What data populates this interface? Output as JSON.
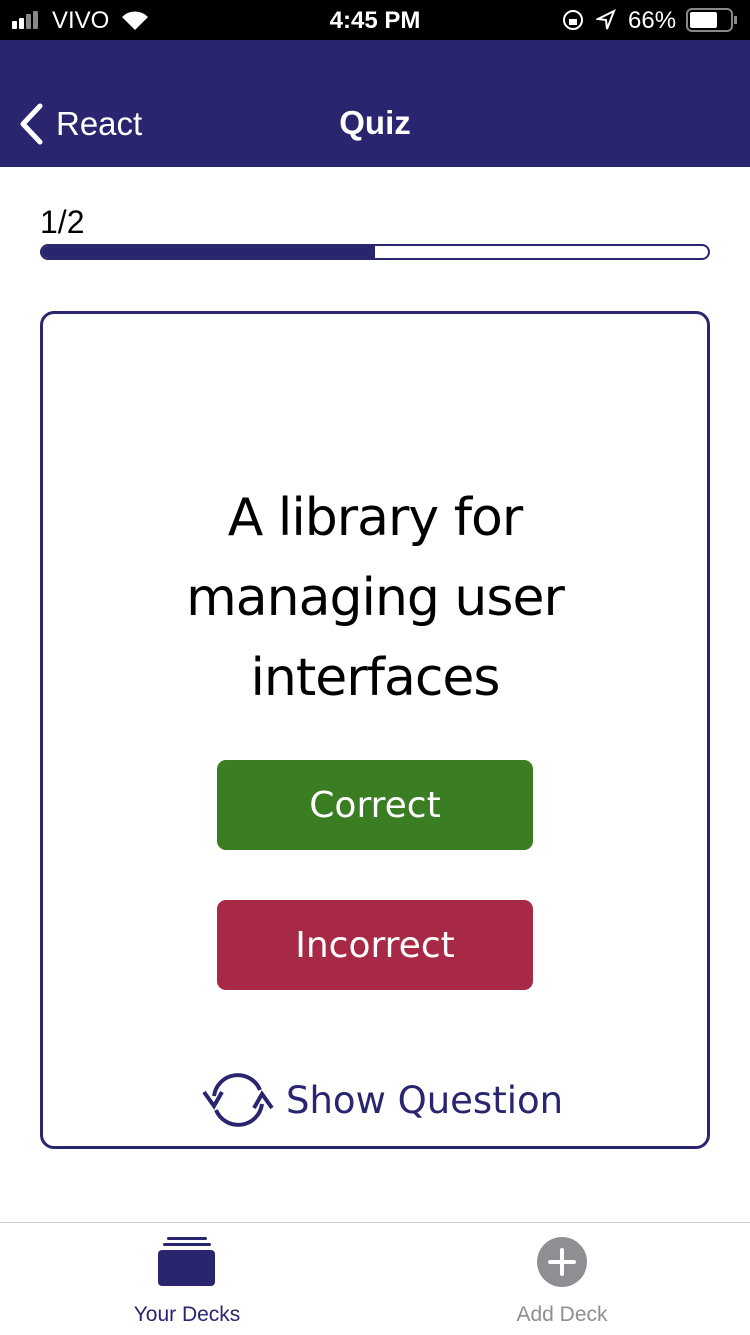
{
  "status_bar": {
    "carrier": "VIVO",
    "time": "4:45 PM",
    "battery": "66%",
    "battery_level": 0.66,
    "icons": [
      "signal-icon",
      "wifi-icon",
      "orientation-lock-icon",
      "location-icon",
      "battery-icon"
    ]
  },
  "header": {
    "back_label": "React",
    "title": "Quiz"
  },
  "progress": {
    "text": "1/2",
    "fraction": 0.5
  },
  "card": {
    "answer": "A library for managing user interfaces",
    "correct_label": "Correct",
    "incorrect_label": "Incorrect",
    "flip_label": "Show Question"
  },
  "tabs": [
    {
      "label": "Your Decks",
      "active": true,
      "icon": "decks-icon"
    },
    {
      "label": "Add Deck",
      "active": false,
      "icon": "add-circle-icon"
    }
  ],
  "colors": {
    "primary": "#29256f",
    "correct": "#3a7d22",
    "incorrect": "#a82945",
    "inactive": "#8e8e93"
  }
}
